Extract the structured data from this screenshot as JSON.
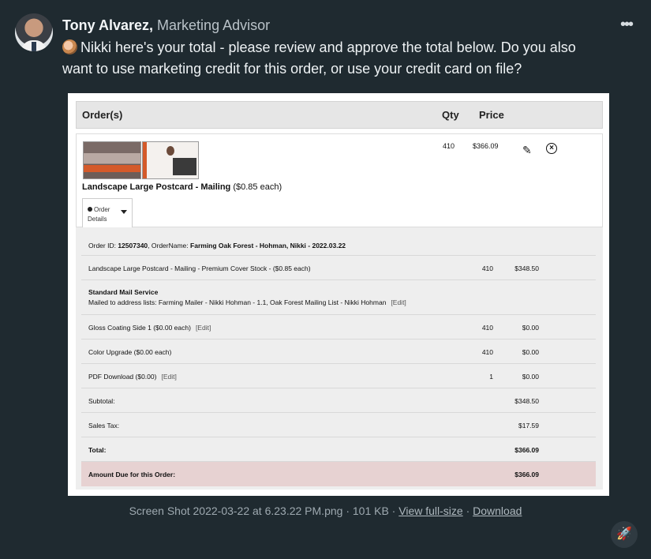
{
  "sender": {
    "name": "Tony Alvarez,",
    "role": "Marketing Advisor"
  },
  "message": {
    "text": "Nikki here's your total - please review and approve the total below. Do you also want to use marketing credit for this order, or use your credit card on file?"
  },
  "menu_icon": "more-options-icon",
  "order": {
    "header": {
      "col_orders": "Order(s)",
      "col_qty": "Qty",
      "col_price": "Price"
    },
    "item": {
      "name": "Landscape Large Postcard - Mailing",
      "unit": "($0.85 each)",
      "qty": "410",
      "price": "$366.09",
      "tab_line1": "Order",
      "tab_line2": "Details"
    },
    "details": {
      "order_id_label": "Order ID:",
      "order_id": "12507340",
      "order_name_label": ", OrderName:",
      "order_name": "Farming Oak Forest - Hohman, Nikki - 2022.03.22",
      "lines": [
        {
          "text": "Landscape Large Postcard - Mailing - Premium Cover Stock - ($0.85 each)",
          "qty": "410",
          "price": "$348.50"
        },
        {
          "title": "Standard Mail Service",
          "text": "Mailed to address lists: Farming Mailer - Nikki Hohman - 1.1, Oak Forest Mailing List - Nikki Hohman",
          "edit": "[Edit]"
        },
        {
          "text": "Gloss Coating Side 1 ($0.00 each)",
          "edit": "[Edit]",
          "qty": "410",
          "price": "$0.00"
        },
        {
          "text": "Color Upgrade ($0.00 each)",
          "qty": "410",
          "price": "$0.00"
        },
        {
          "text": "PDF Download ($0.00)",
          "edit": "[Edit]",
          "qty": "1",
          "price": "$0.00"
        }
      ],
      "subtotal_label": "Subtotal:",
      "subtotal": "$348.50",
      "tax_label": "Sales Tax:",
      "tax": "$17.59",
      "total_label": "Total:",
      "total": "$366.09",
      "due_label": "Amount Due for this Order:",
      "due": "$366.09"
    }
  },
  "caption": {
    "file": "Screen Shot 2022-03-22 at 6.23.22 PM.png · 101 KB ·",
    "view": "View full-size",
    "sep": "·",
    "download": "Download"
  }
}
